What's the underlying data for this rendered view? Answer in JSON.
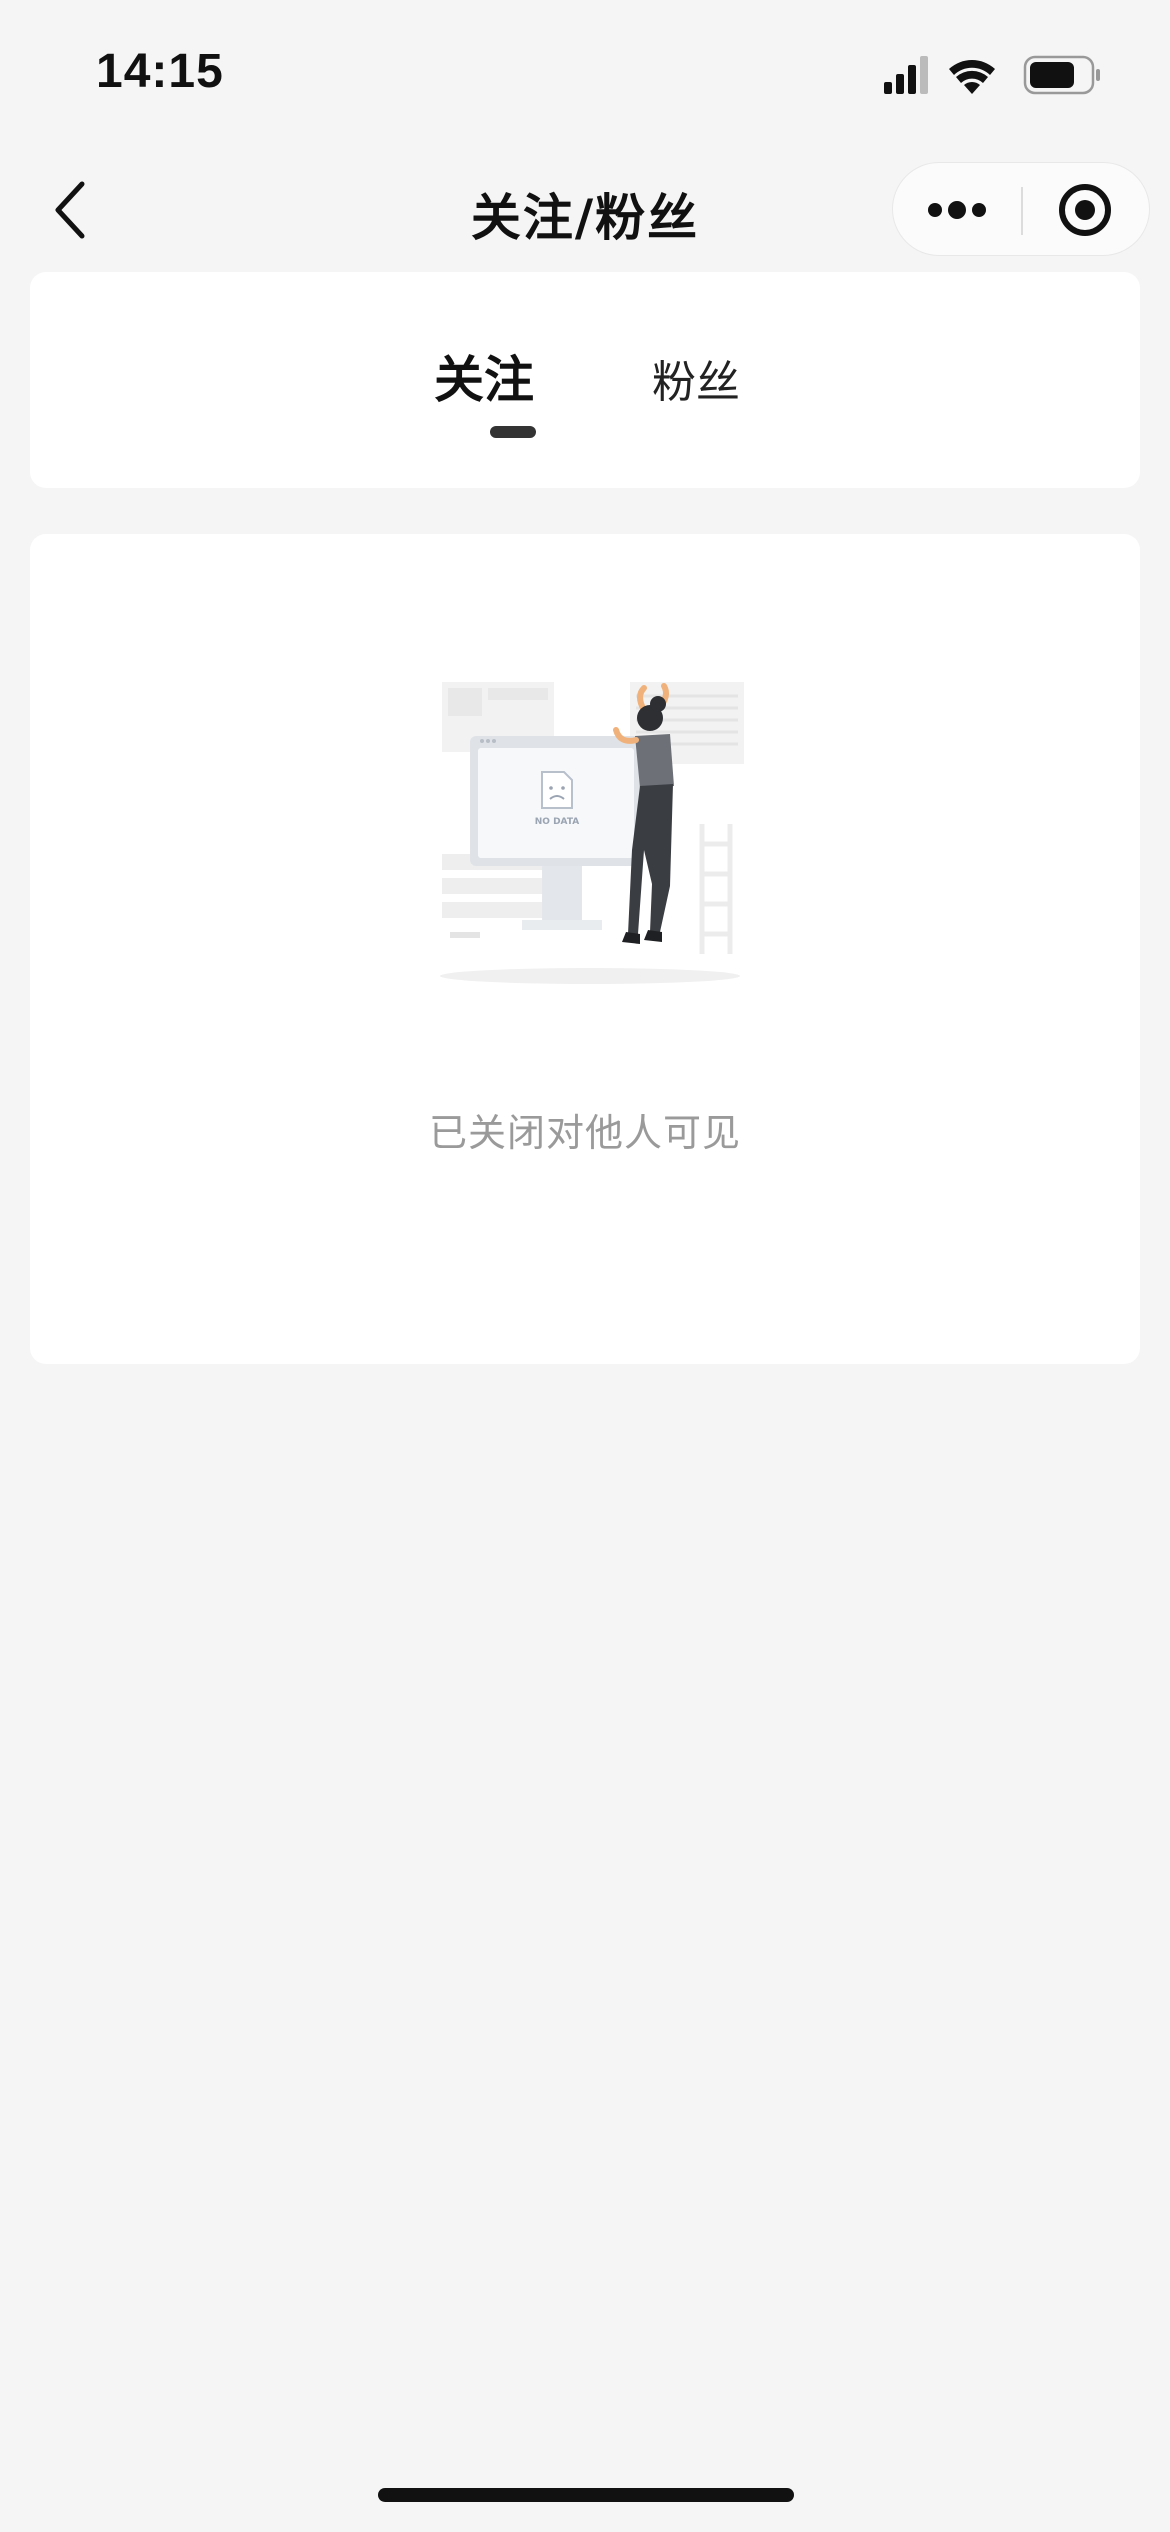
{
  "status_bar": {
    "time": "14:15",
    "icons": [
      "signal-icon",
      "wifi-icon",
      "battery-icon"
    ]
  },
  "nav": {
    "title": "关注/粉丝",
    "back_icon": "chevron-left-icon",
    "more_icon": "more-dots-icon",
    "close_icon": "target-circle-icon"
  },
  "tabs": [
    {
      "label": "关注",
      "active": true
    },
    {
      "label": "粉丝",
      "active": false
    }
  ],
  "empty_state": {
    "illustration_text": "NO DATA",
    "message": "已关闭对他人可见"
  },
  "colors": {
    "background": "#f5f5f5",
    "card": "#ffffff",
    "muted_text": "#9a9a9a",
    "indicator": "#333333"
  }
}
